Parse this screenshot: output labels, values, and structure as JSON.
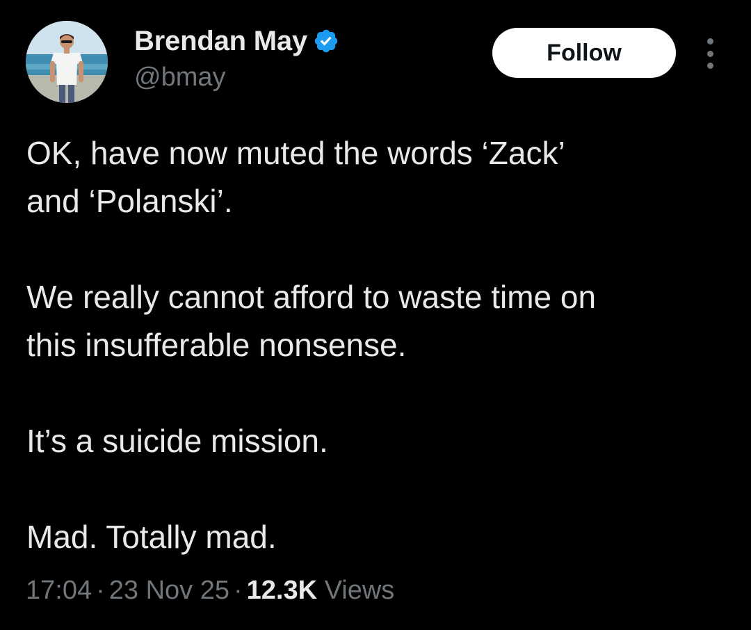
{
  "author": {
    "display_name": "Brendan May",
    "handle": "@bmay",
    "verified_icon": "verified-badge-icon",
    "avatar_icon": "profile-photo"
  },
  "actions": {
    "follow_label": "Follow",
    "more_icon": "more-vertical-icon"
  },
  "tweet": {
    "paragraphs": [
      "OK, have now muted the words ‘Zack’\nand ‘Polanski’.",
      "We really cannot afford to waste time on\nthis insufferable nonsense.",
      "It’s a suicide mission.",
      "Mad. Totally mad."
    ]
  },
  "meta": {
    "time": "17:04",
    "separator": "·",
    "date": "23 Nov 25",
    "views_count": "12.3K",
    "views_label": "Views"
  },
  "colors": {
    "background": "#000000",
    "text_primary": "#e7e9ea",
    "text_secondary": "#71767b",
    "verified_blue": "#1d9bf0",
    "follow_bg": "#ffffff",
    "follow_text": "#0f1419"
  }
}
